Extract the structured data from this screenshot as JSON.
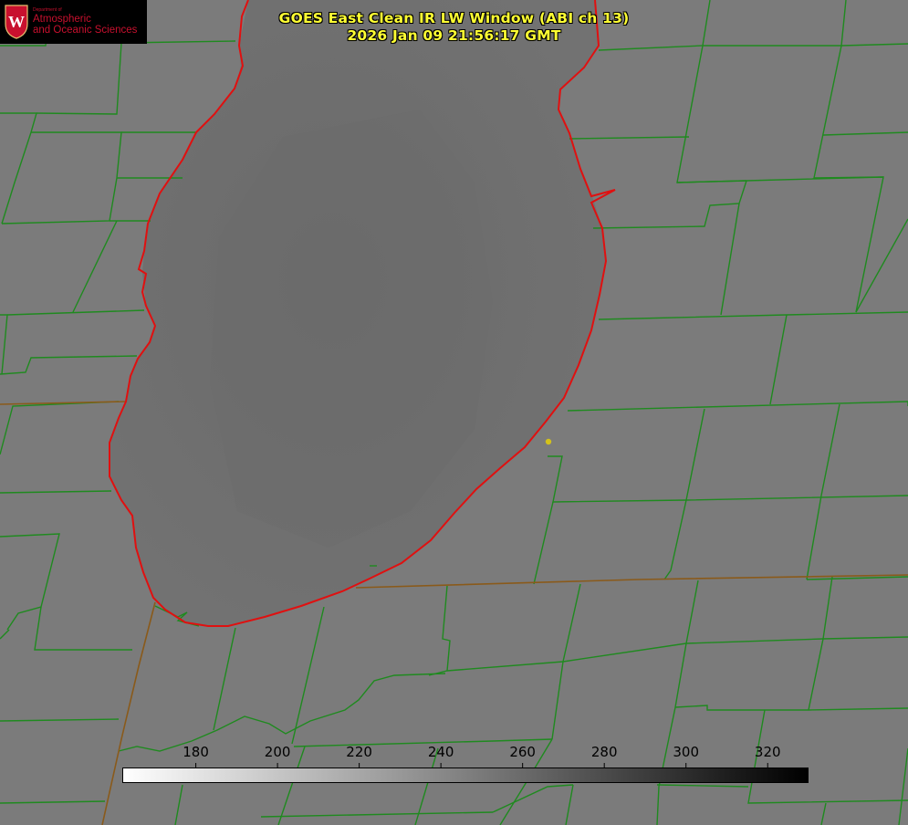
{
  "logo": {
    "department": "Department of",
    "line1": "Atmospheric",
    "line2": "and Oceanic Sciences",
    "seal_letter": "W",
    "colors": {
      "text": "#c8102e",
      "seal": "#c8102e"
    }
  },
  "title": {
    "line1": "GOES East Clean IR LW Window (ABI ch 13)",
    "line2": "2026 Jan 09 21:56:17 GMT",
    "color": "#ffff33"
  },
  "colorbar": {
    "orientation": "horizontal",
    "unit_label": "",
    "range": [
      162,
      330
    ],
    "gradient": [
      "#ffffff",
      "#000000"
    ],
    "ticks": [
      {
        "label": "180",
        "value": 180
      },
      {
        "label": "200",
        "value": 200
      },
      {
        "label": "220",
        "value": 220
      },
      {
        "label": "240",
        "value": 240
      },
      {
        "label": "260",
        "value": 260
      },
      {
        "label": "280",
        "value": 280
      },
      {
        "label": "300",
        "value": 300
      },
      {
        "label": "320",
        "value": 320
      }
    ]
  },
  "map": {
    "background_gray": "#7b7b7b",
    "lake_gray": "#6f6f6f",
    "county_line_color": "#1f8a1f",
    "state_line_color": "#8a5a1a",
    "coastline_color": "#e01010",
    "marker_color": "#d4c21a"
  }
}
